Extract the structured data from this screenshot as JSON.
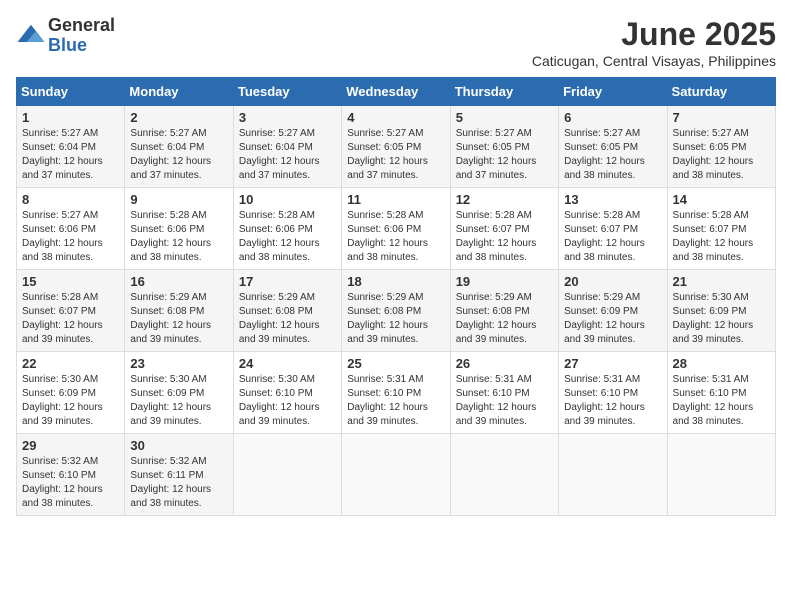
{
  "logo": {
    "general": "General",
    "blue": "Blue"
  },
  "title": "June 2025",
  "location": "Caticugan, Central Visayas, Philippines",
  "days_of_week": [
    "Sunday",
    "Monday",
    "Tuesday",
    "Wednesday",
    "Thursday",
    "Friday",
    "Saturday"
  ],
  "weeks": [
    [
      {
        "day": "1",
        "sunrise": "5:27 AM",
        "sunset": "6:04 PM",
        "daylight": "12 hours and 37 minutes."
      },
      {
        "day": "2",
        "sunrise": "5:27 AM",
        "sunset": "6:04 PM",
        "daylight": "12 hours and 37 minutes."
      },
      {
        "day": "3",
        "sunrise": "5:27 AM",
        "sunset": "6:04 PM",
        "daylight": "12 hours and 37 minutes."
      },
      {
        "day": "4",
        "sunrise": "5:27 AM",
        "sunset": "6:05 PM",
        "daylight": "12 hours and 37 minutes."
      },
      {
        "day": "5",
        "sunrise": "5:27 AM",
        "sunset": "6:05 PM",
        "daylight": "12 hours and 37 minutes."
      },
      {
        "day": "6",
        "sunrise": "5:27 AM",
        "sunset": "6:05 PM",
        "daylight": "12 hours and 38 minutes."
      },
      {
        "day": "7",
        "sunrise": "5:27 AM",
        "sunset": "6:05 PM",
        "daylight": "12 hours and 38 minutes."
      }
    ],
    [
      {
        "day": "8",
        "sunrise": "5:27 AM",
        "sunset": "6:06 PM",
        "daylight": "12 hours and 38 minutes."
      },
      {
        "day": "9",
        "sunrise": "5:28 AM",
        "sunset": "6:06 PM",
        "daylight": "12 hours and 38 minutes."
      },
      {
        "day": "10",
        "sunrise": "5:28 AM",
        "sunset": "6:06 PM",
        "daylight": "12 hours and 38 minutes."
      },
      {
        "day": "11",
        "sunrise": "5:28 AM",
        "sunset": "6:06 PM",
        "daylight": "12 hours and 38 minutes."
      },
      {
        "day": "12",
        "sunrise": "5:28 AM",
        "sunset": "6:07 PM",
        "daylight": "12 hours and 38 minutes."
      },
      {
        "day": "13",
        "sunrise": "5:28 AM",
        "sunset": "6:07 PM",
        "daylight": "12 hours and 38 minutes."
      },
      {
        "day": "14",
        "sunrise": "5:28 AM",
        "sunset": "6:07 PM",
        "daylight": "12 hours and 38 minutes."
      }
    ],
    [
      {
        "day": "15",
        "sunrise": "5:28 AM",
        "sunset": "6:07 PM",
        "daylight": "12 hours and 39 minutes."
      },
      {
        "day": "16",
        "sunrise": "5:29 AM",
        "sunset": "6:08 PM",
        "daylight": "12 hours and 39 minutes."
      },
      {
        "day": "17",
        "sunrise": "5:29 AM",
        "sunset": "6:08 PM",
        "daylight": "12 hours and 39 minutes."
      },
      {
        "day": "18",
        "sunrise": "5:29 AM",
        "sunset": "6:08 PM",
        "daylight": "12 hours and 39 minutes."
      },
      {
        "day": "19",
        "sunrise": "5:29 AM",
        "sunset": "6:08 PM",
        "daylight": "12 hours and 39 minutes."
      },
      {
        "day": "20",
        "sunrise": "5:29 AM",
        "sunset": "6:09 PM",
        "daylight": "12 hours and 39 minutes."
      },
      {
        "day": "21",
        "sunrise": "5:30 AM",
        "sunset": "6:09 PM",
        "daylight": "12 hours and 39 minutes."
      }
    ],
    [
      {
        "day": "22",
        "sunrise": "5:30 AM",
        "sunset": "6:09 PM",
        "daylight": "12 hours and 39 minutes."
      },
      {
        "day": "23",
        "sunrise": "5:30 AM",
        "sunset": "6:09 PM",
        "daylight": "12 hours and 39 minutes."
      },
      {
        "day": "24",
        "sunrise": "5:30 AM",
        "sunset": "6:10 PM",
        "daylight": "12 hours and 39 minutes."
      },
      {
        "day": "25",
        "sunrise": "5:31 AM",
        "sunset": "6:10 PM",
        "daylight": "12 hours and 39 minutes."
      },
      {
        "day": "26",
        "sunrise": "5:31 AM",
        "sunset": "6:10 PM",
        "daylight": "12 hours and 39 minutes."
      },
      {
        "day": "27",
        "sunrise": "5:31 AM",
        "sunset": "6:10 PM",
        "daylight": "12 hours and 39 minutes."
      },
      {
        "day": "28",
        "sunrise": "5:31 AM",
        "sunset": "6:10 PM",
        "daylight": "12 hours and 38 minutes."
      }
    ],
    [
      {
        "day": "29",
        "sunrise": "5:32 AM",
        "sunset": "6:10 PM",
        "daylight": "12 hours and 38 minutes."
      },
      {
        "day": "30",
        "sunrise": "5:32 AM",
        "sunset": "6:11 PM",
        "daylight": "12 hours and 38 minutes."
      },
      null,
      null,
      null,
      null,
      null
    ]
  ]
}
